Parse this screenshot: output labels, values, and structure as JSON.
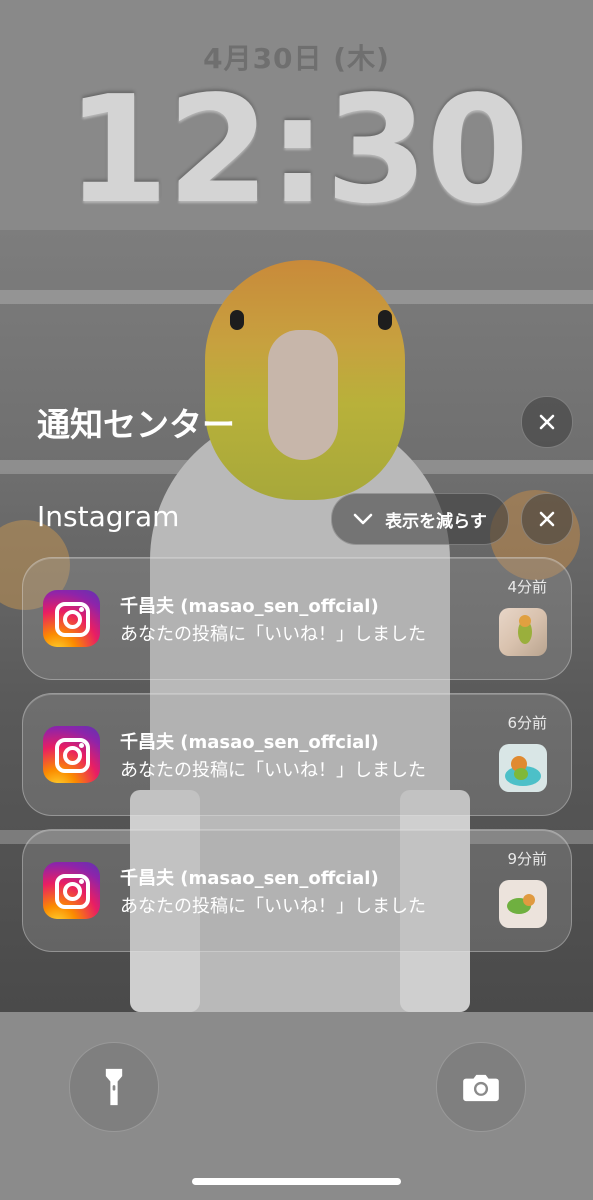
{
  "lockscreen": {
    "date": "4月30日 (木)",
    "time": "12:30"
  },
  "notification_center": {
    "title": "通知センター",
    "group": {
      "app_name": "Instagram",
      "show_less_label": "表示を減らす"
    },
    "notifications": [
      {
        "sender": "千昌夫 (masao_sen_offcial)",
        "body": "あなたの投稿に「いいね！」しました",
        "time": "4分前"
      },
      {
        "sender": "千昌夫 (masao_sen_offcial)",
        "body": "あなたの投稿に「いいね！」しました",
        "time": "6分前"
      },
      {
        "sender": "千昌夫 (masao_sen_offcial)",
        "body": "あなたの投稿に「いいね！」しました",
        "time": "9分前"
      }
    ]
  },
  "quick_actions": {
    "left_icon": "flashlight-icon",
    "right_icon": "camera-icon"
  }
}
